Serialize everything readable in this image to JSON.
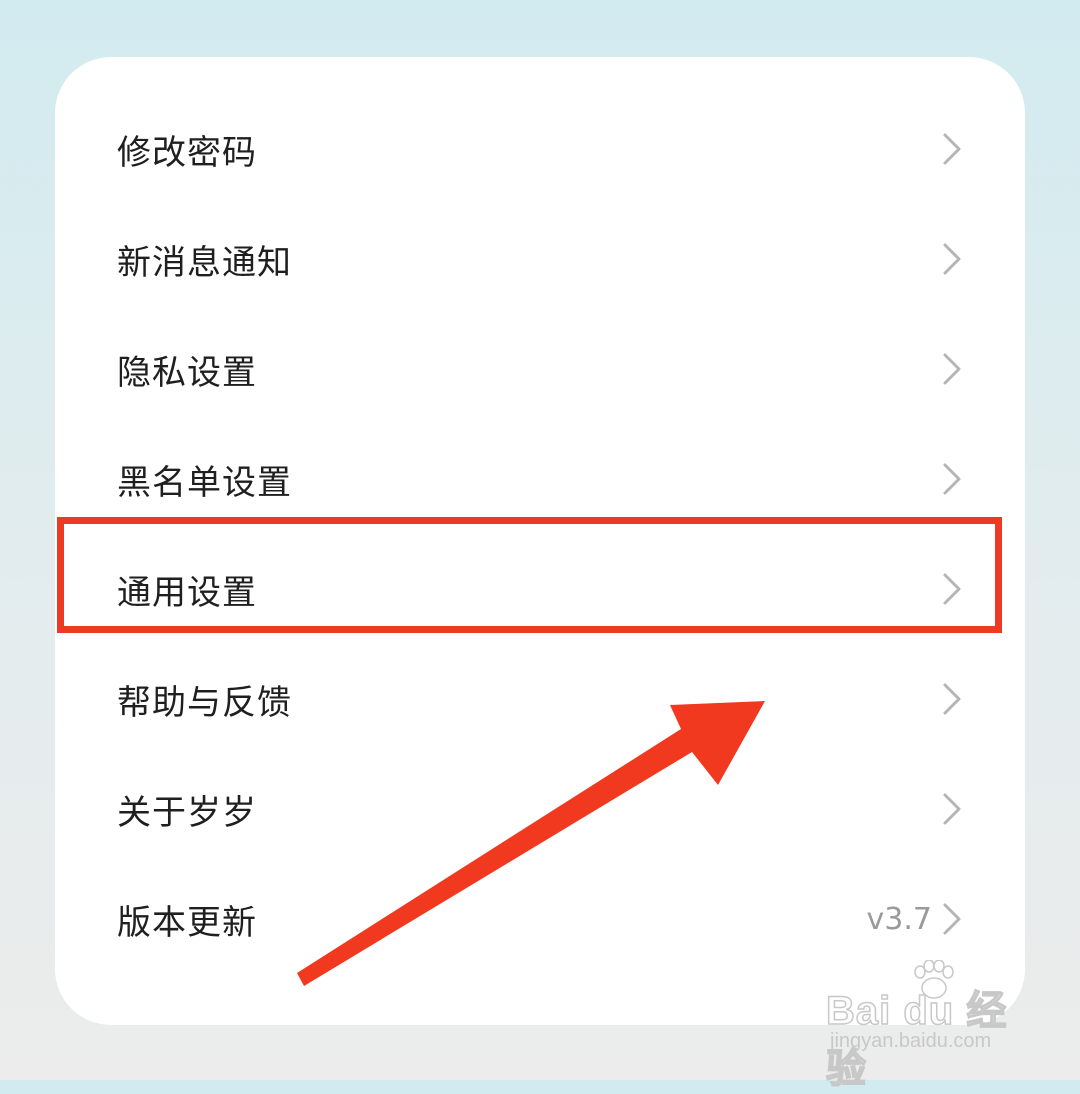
{
  "menu": {
    "items": [
      {
        "label": "修改密码",
        "value": ""
      },
      {
        "label": "新消息通知",
        "value": ""
      },
      {
        "label": "隐私设置",
        "value": ""
      },
      {
        "label": "黑名单设置",
        "value": ""
      },
      {
        "label": "通用设置",
        "value": ""
      },
      {
        "label": "帮助与反馈",
        "value": ""
      },
      {
        "label": "关于岁岁",
        "value": ""
      },
      {
        "label": "版本更新",
        "value": "v3.7"
      }
    ]
  },
  "annotation": {
    "highlighted_item": "通用设置",
    "color": "#ee3a22"
  },
  "watermark": {
    "logo_text": "Bai du 经验",
    "site": "jingyan.baidu.com"
  },
  "colors": {
    "card_background": "#ffffff",
    "label_text": "#1f1f1f",
    "value_text": "#9a9a9a",
    "chevron": "#b5b5b5",
    "page_background_top": "#d2ebf0",
    "page_background_bottom": "#ececec"
  },
  "icons": {
    "row_chevron": "chevron-right-icon",
    "pointer": "arrow-icon",
    "watermark_mark": "paw-icon"
  }
}
